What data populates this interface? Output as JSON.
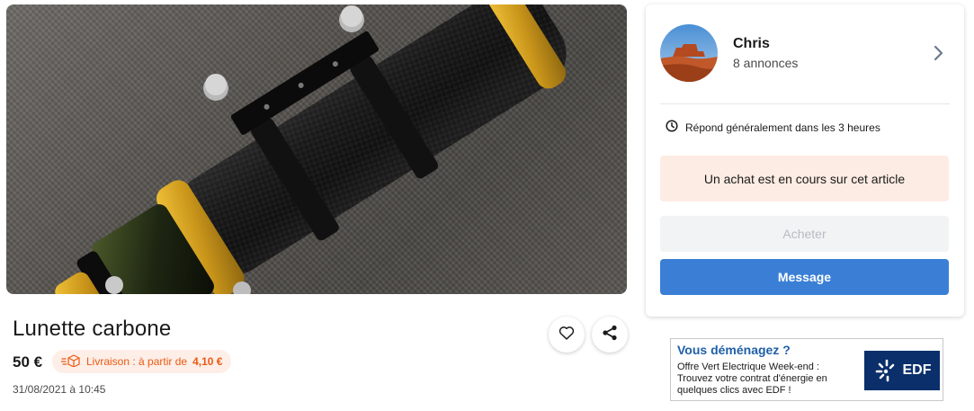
{
  "product": {
    "photo_alt": "product-photo",
    "title": "Lunette carbone",
    "price": "50 €",
    "delivery_prefix": "Livraison : à partir de",
    "delivery_price": "4,10 €",
    "date": "31/08/2021 à 10:45"
  },
  "seller": {
    "name": "Chris",
    "listings": "8 annonces",
    "response_time": "Répond généralement dans les 3 heures"
  },
  "purchase": {
    "notice": "Un achat est en cours sur cet article",
    "buy_label": "Acheter",
    "message_label": "Message"
  },
  "ad": {
    "title": "Vous déménagez ?",
    "line1": "Offre Vert Electrique Week-end :",
    "line2": "Trouvez votre contrat d'énergie en",
    "line3": "quelques clics avec EDF !",
    "logo_text": "EDF"
  },
  "colors": {
    "accent_orange": "#ec5a13",
    "primary_blue": "#3a7fd5",
    "ad_blue": "#1f5fa8"
  }
}
